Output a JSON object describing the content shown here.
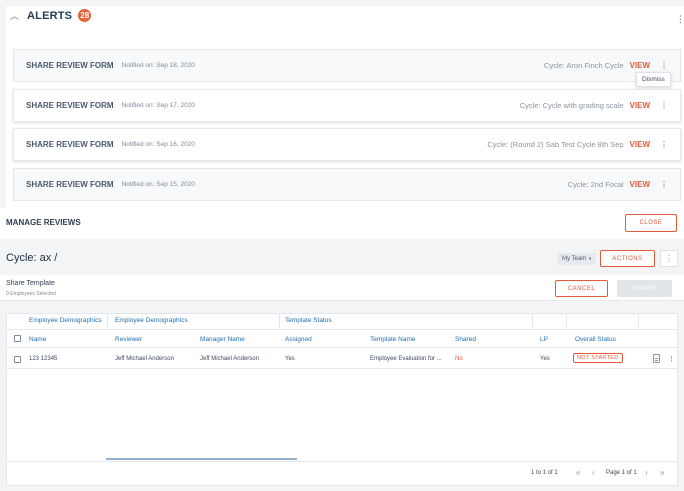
{
  "alerts": {
    "title": "ALERTS",
    "count": "28",
    "items": [
      {
        "title": "SHARE REVIEW FORM",
        "notified": "Notified on: Sep 18, 2020",
        "cycle": "Cycle: Aron Finch Cycle",
        "view": "VIEW"
      },
      {
        "title": "SHARE REVIEW FORM",
        "notified": "Notified on: Sep 17, 2020",
        "cycle": "Cycle: Cycle with grading scale",
        "view": "VIEW"
      },
      {
        "title": "SHARE REVIEW FORM",
        "notified": "Notified on: Sep 16, 2020",
        "cycle": "Cycle: (Round 2) Sab Test Cycle 8th Sep",
        "view": "VIEW"
      },
      {
        "title": "SHARE REVIEW FORM",
        "notified": "Notified on: Sep 15, 2020",
        "cycle": "Cycle: 2nd Focal",
        "view": "VIEW"
      }
    ],
    "dismiss_label": "Dismiss"
  },
  "manage": {
    "title": "MANAGE REVIEWS",
    "close_label": "CLOSE"
  },
  "cycle": {
    "title": "Cycle: ax /",
    "team_select": "My Team",
    "actions_label": "ACTIONS"
  },
  "share": {
    "title": "Share Template",
    "subtitle": "0 Employees Selected",
    "cancel_label": "CANCEL",
    "share_label": "SHARE"
  },
  "grid": {
    "groups": [
      "Employee Demographics",
      "Employee Demographics",
      "Template Status"
    ],
    "columns": [
      "Name",
      "Reviewer",
      "Manager Name",
      "Assigned",
      "Template Name",
      "Shared",
      "LP",
      "Overall Status"
    ],
    "rows": [
      {
        "name": "123 12345",
        "reviewer": "Jeff Michael Anderson",
        "manager": "Jeff Michael Anderson",
        "assigned": "Yes",
        "template": "Employee Evaluation for ...",
        "shared": "No",
        "lp": "Yes",
        "status": "NOT STARTED"
      }
    ],
    "pager": {
      "range": "1 to 1 of 1",
      "page": "Page 1 of 1"
    }
  },
  "colors": {
    "accent": "#e35a3a",
    "link": "#1f6fb2",
    "title": "#1f3b56"
  }
}
